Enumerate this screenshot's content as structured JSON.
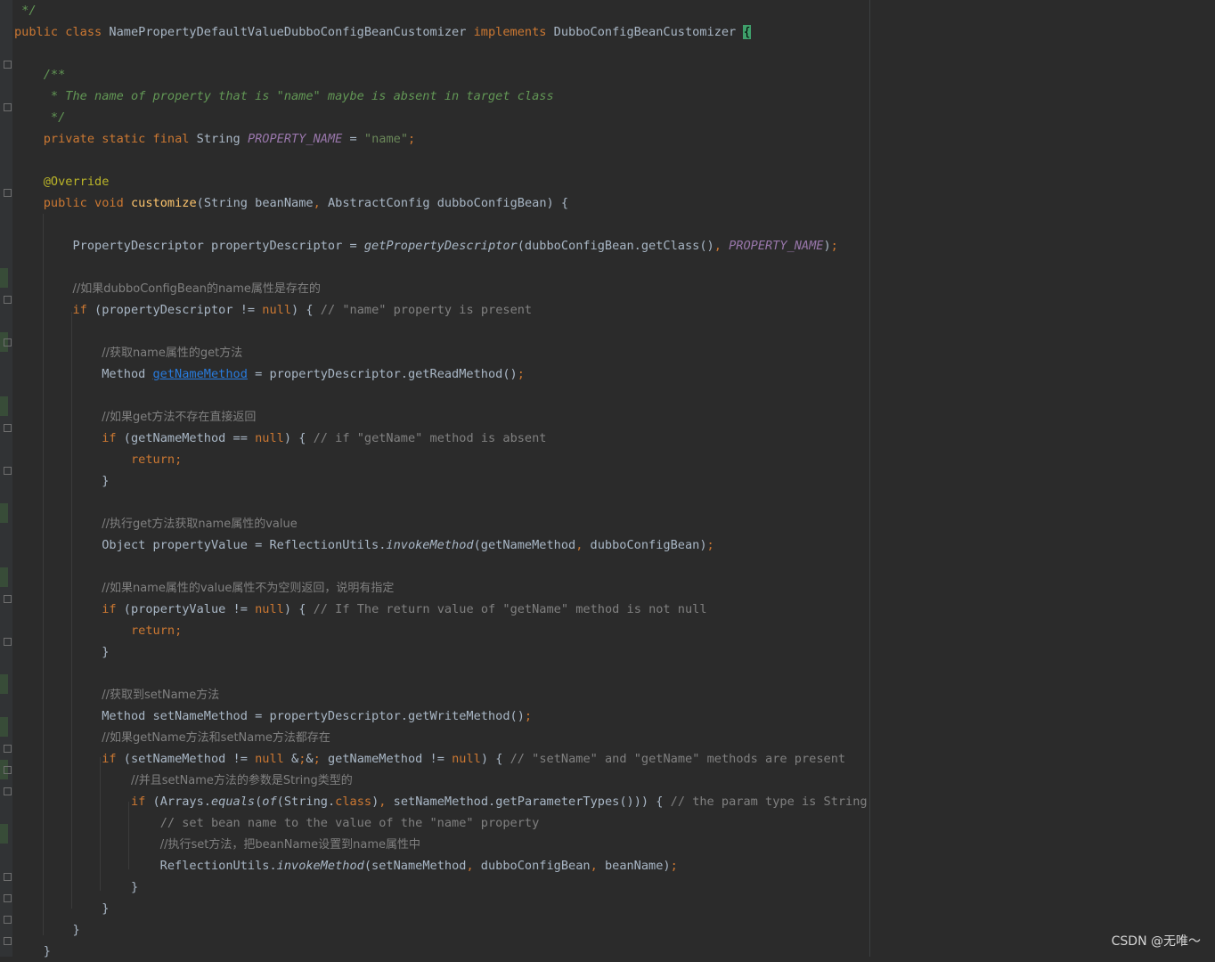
{
  "editor": {
    "lines": [
      {
        "id": "l0",
        "text": " */"
      },
      {
        "id": "l1",
        "text": "public class NamePropertyDefaultValueDubboConfigBeanCustomizer implements DubboConfigBeanCustomizer {"
      },
      {
        "id": "l3",
        "text": "    /**"
      },
      {
        "id": "l4",
        "text": "     * The name of property that is \"name\" maybe is absent in target class"
      },
      {
        "id": "l5",
        "text": "     */"
      },
      {
        "id": "l6",
        "text": "    private static final String PROPERTY_NAME = \"name\";"
      },
      {
        "id": "l8",
        "text": "    @Override"
      },
      {
        "id": "l9",
        "text": "    public void customize(String beanName, AbstractConfig dubboConfigBean) {"
      },
      {
        "id": "l11",
        "text": "        PropertyDescriptor propertyDescriptor = getPropertyDescriptor(dubboConfigBean.getClass(), PROPERTY_NAME);"
      },
      {
        "id": "l13",
        "text": "        //如果dubboConfigBean的name属性是存在的"
      },
      {
        "id": "l14",
        "text": "        if (propertyDescriptor != null) { // \"name\" property is present"
      },
      {
        "id": "l16",
        "text": "            //获取name属性的get方法"
      },
      {
        "id": "l17",
        "text": "            Method getNameMethod = propertyDescriptor.getReadMethod();"
      },
      {
        "id": "l19",
        "text": "            //如果get方法不存在直接返回"
      },
      {
        "id": "l20",
        "text": "            if (getNameMethod == null) { // if \"getName\" method is absent"
      },
      {
        "id": "l21",
        "text": "                return;"
      },
      {
        "id": "l22",
        "text": "            }"
      },
      {
        "id": "l24",
        "text": "            //执行get方法获取name属性的value"
      },
      {
        "id": "l25",
        "text": "            Object propertyValue = ReflectionUtils.invokeMethod(getNameMethod, dubboConfigBean);"
      },
      {
        "id": "l27",
        "text": "            //如果name属性的value属性不为空则返回，说明有指定"
      },
      {
        "id": "l28",
        "text": "            if (propertyValue != null) { // If The return value of \"getName\" method is not null"
      },
      {
        "id": "l29",
        "text": "                return;"
      },
      {
        "id": "l30",
        "text": "            }"
      },
      {
        "id": "l32",
        "text": "            //获取到setName方法"
      },
      {
        "id": "l33",
        "text": "            Method setNameMethod = propertyDescriptor.getWriteMethod();"
      },
      {
        "id": "l34",
        "text": "            //如果getName方法和setName方法都存在"
      },
      {
        "id": "l35",
        "text": "            if (setNameMethod != null && getNameMethod != null) { // \"setName\" and \"getName\" methods are present"
      },
      {
        "id": "l36",
        "text": "                //并且setName方法的参数是String类型的"
      },
      {
        "id": "l37",
        "text": "                if (Arrays.equals(of(String.class), setNameMethod.getParameterTypes())) { // the param type is String"
      },
      {
        "id": "l38",
        "text": "                    // set bean name to the value of the \"name\" property"
      },
      {
        "id": "l39",
        "text": "                    //执行set方法，把beanName设置到name属性中"
      },
      {
        "id": "l40",
        "text": "                    ReflectionUtils.invokeMethod(setNameMethod, dubboConfigBean, beanName);"
      },
      {
        "id": "l41",
        "text": "                }"
      },
      {
        "id": "l42",
        "text": "            }"
      },
      {
        "id": "l43",
        "text": "        }"
      },
      {
        "id": "l44",
        "text": "    }"
      }
    ]
  },
  "watermark": "CSDN @无唯～",
  "colors": {
    "background": "#2b2b2b",
    "keyword": "#cc7832",
    "string": "#6a8759",
    "comment": "#808080",
    "doc_comment": "#629755",
    "method_decl": "#ffc66d",
    "constant": "#9876aa",
    "annotation": "#bbb529",
    "text": "#a9b7c6"
  }
}
